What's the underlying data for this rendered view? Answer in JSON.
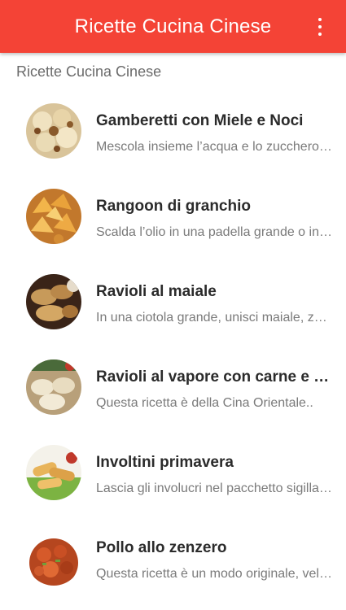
{
  "app_bar": {
    "title": "Ricette Cucina Cinese",
    "menu_icon": "more-vert-icon",
    "color": "#f44336"
  },
  "section_header": "Ricette Cucina Cinese",
  "recipes": [
    {
      "title": "Gamberetti con Miele e Noci",
      "subtitle": "Mescola insieme l’acqua e lo zucchero in una padella",
      "image": "honey-walnut-shrimp-photo"
    },
    {
      "title": "Rangoon di granchio",
      "subtitle": "Scalda l’olio in una padella grande o in una friggitrice",
      "image": "crab-rangoon-photo"
    },
    {
      "title": "Ravioli al maiale",
      "subtitle": "In una ciotola grande, unisci maiale, zenzero e cipolla",
      "image": "pork-dumplings-photo"
    },
    {
      "title": "Ravioli al vapore con carne e verdure",
      "subtitle": "Questa ricetta è della Cina Orientale..",
      "image": "steamed-dumplings-photo"
    },
    {
      "title": "Involtini primavera",
      "subtitle": "Lascia gli involucri nel pacchetto sigillato finché pronti",
      "image": "spring-rolls-photo"
    },
    {
      "title": "Pollo allo zenzero",
      "subtitle": "Questa ricetta è un modo originale, veloce e gustoso",
      "image": "ginger-chicken-photo"
    }
  ]
}
